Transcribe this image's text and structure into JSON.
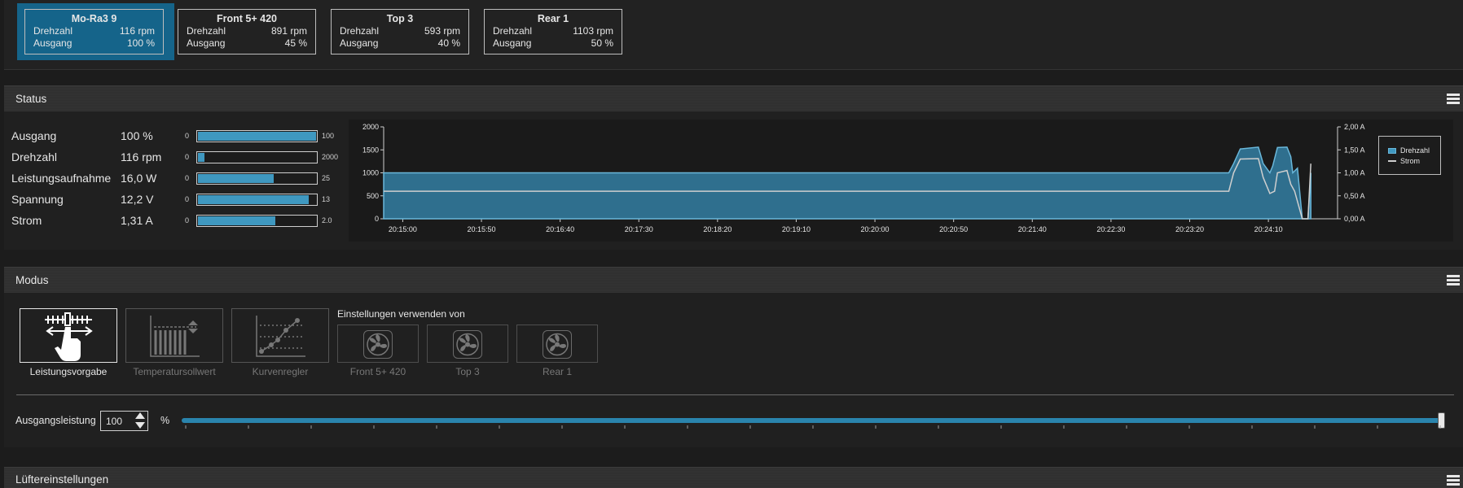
{
  "fans": [
    {
      "name": "Mo-Ra3 9",
      "rpm_label": "Drehzahl",
      "rpm": "116 rpm",
      "out_label": "Ausgang",
      "out": "100 %",
      "active": true
    },
    {
      "name": "Front 5+ 420",
      "rpm_label": "Drehzahl",
      "rpm": "891 rpm",
      "out_label": "Ausgang",
      "out": "45 %",
      "active": false
    },
    {
      "name": "Top 3",
      "rpm_label": "Drehzahl",
      "rpm": "593 rpm",
      "out_label": "Ausgang",
      "out": "40 %",
      "active": false
    },
    {
      "name": "Rear 1",
      "rpm_label": "Drehzahl",
      "rpm": "1103 rpm",
      "out_label": "Ausgang",
      "out": "50 %",
      "active": false
    }
  ],
  "status": {
    "title": "Status",
    "rows": [
      {
        "label": "Ausgang",
        "value": "100 %",
        "min": "0",
        "max": "100",
        "fraction": 1.0
      },
      {
        "label": "Drehzahl",
        "value": "116 rpm",
        "min": "0",
        "max": "2000",
        "fraction": 0.058
      },
      {
        "label": "Leistungsaufnahme",
        "value": "16,0 W",
        "min": "0",
        "max": "25",
        "fraction": 0.64
      },
      {
        "label": "Spannung",
        "value": "12,2 V",
        "min": "0",
        "max": "13",
        "fraction": 0.94
      },
      {
        "label": "Strom",
        "value": "1,31 A",
        "min": "0",
        "max": "2.0",
        "fraction": 0.655
      }
    ]
  },
  "chart_data": {
    "type": "area",
    "x": [
      "20:15:00",
      "20:15:50",
      "20:16:40",
      "20:17:30",
      "20:18:20",
      "20:19:10",
      "20:20:00",
      "20:20:50",
      "20:21:40",
      "20:22:30",
      "20:23:20",
      "20:24:10"
    ],
    "y_left_ticks": [
      "2000",
      "1500",
      "1000",
      "500",
      "0"
    ],
    "y_right_ticks": [
      "2,00 A",
      "1,50 A",
      "1,00 A",
      "0,50 A",
      "0,00 A"
    ],
    "ylim_left": [
      0,
      2000
    ],
    "ylim_right": [
      0,
      2
    ],
    "series": [
      {
        "name": "Drehzahl",
        "color": "#2f6f8e",
        "points": [
          [
            0,
            1000
          ],
          [
            0.886,
            1000
          ],
          [
            0.891,
            1200
          ],
          [
            0.898,
            1520
          ],
          [
            0.917,
            1560
          ],
          [
            0.922,
            1200
          ],
          [
            0.929,
            1000
          ],
          [
            0.932,
            1150
          ],
          [
            0.937,
            1550
          ],
          [
            0.947,
            1560
          ],
          [
            0.951,
            1350
          ],
          [
            0.953,
            1000
          ],
          [
            0.958,
            1100
          ],
          [
            0.963,
            0
          ],
          [
            0.969,
            0
          ],
          [
            0.972,
            1000
          ]
        ]
      },
      {
        "name": "Strom",
        "color": "#cfcfcf",
        "points": [
          [
            0,
            0.6
          ],
          [
            0.886,
            0.6
          ],
          [
            0.891,
            1.0
          ],
          [
            0.898,
            1.3
          ],
          [
            0.917,
            1.31
          ],
          [
            0.922,
            0.9
          ],
          [
            0.929,
            0.55
          ],
          [
            0.934,
            0.6
          ],
          [
            0.937,
            1.0
          ],
          [
            0.947,
            1.05
          ],
          [
            0.951,
            0.75
          ],
          [
            0.955,
            0.6
          ],
          [
            0.963,
            0.0
          ],
          [
            0.969,
            0.0
          ],
          [
            0.972,
            1.2
          ]
        ]
      }
    ],
    "legend": [
      "Drehzahl",
      "Strom"
    ],
    "legend_position": "right"
  },
  "modus": {
    "title": "Modus",
    "modes": [
      {
        "label": "Leistungsvorgabe",
        "icon": "manual-slider-hand-icon",
        "active": true
      },
      {
        "label": "Temperatursollwert",
        "icon": "temperature-setpoint-icon",
        "active": false
      },
      {
        "label": "Kurvenregler",
        "icon": "curve-controller-icon",
        "active": false
      }
    ],
    "use_settings_label": "Einstellungen verwenden von",
    "use_from": [
      {
        "label": "Front 5+ 420",
        "icon": "fan-icon"
      },
      {
        "label": "Top 3",
        "icon": "fan-icon"
      },
      {
        "label": "Rear 1",
        "icon": "fan-icon"
      }
    ],
    "output_label": "Ausgangsleistung",
    "output_value": "100",
    "output_unit": "%",
    "slider_value": 100,
    "slider_max": 100
  },
  "fan_settings": {
    "title": "Lüftereinstellungen"
  },
  "colors": {
    "accent": "#3f98c0",
    "active_card": "#15648a",
    "chart_fill": "#2f6f8e"
  }
}
